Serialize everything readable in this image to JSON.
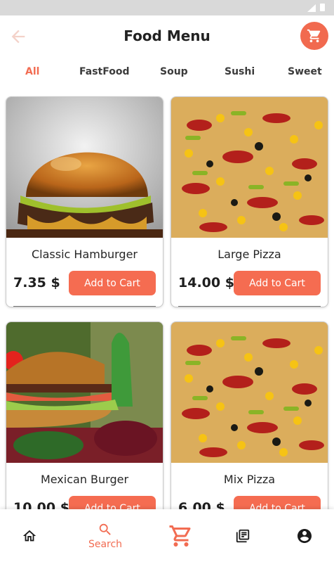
{
  "header": {
    "title": "Food Menu",
    "back_icon": "arrow-back-icon",
    "cart_icon": "shopping-cart-icon"
  },
  "categories": [
    {
      "label": "All",
      "active": true
    },
    {
      "label": "FastFood",
      "active": false
    },
    {
      "label": "Soup",
      "active": false
    },
    {
      "label": "Sushi",
      "active": false
    },
    {
      "label": "Sweet",
      "active": false
    }
  ],
  "products": [
    {
      "name": "Classic Hamburger",
      "price": "7.35 $",
      "button": "Add to Cart",
      "image": "hamburger-photo"
    },
    {
      "name": "Large Pizza",
      "price": "14.00 $",
      "button": "Add to Cart",
      "image": "pizza-photo"
    },
    {
      "name": "Mexican Burger",
      "price": "10.00 $",
      "button": "Add to Cart",
      "image": "mexican-burger-photo"
    },
    {
      "name": "Mix Pizza",
      "price": "6.00 $",
      "button": "Add to Cart",
      "image": "pizza-photo"
    }
  ],
  "bottom_nav": {
    "home_icon": "home-icon",
    "search": {
      "label": "Search",
      "icon": "search-icon"
    },
    "cart_icon": "shopping-cart-icon",
    "orders_icon": "library-books-icon",
    "account_icon": "account-circle-icon"
  },
  "colors": {
    "accent": "#f26c52",
    "button": "#f56c51"
  }
}
